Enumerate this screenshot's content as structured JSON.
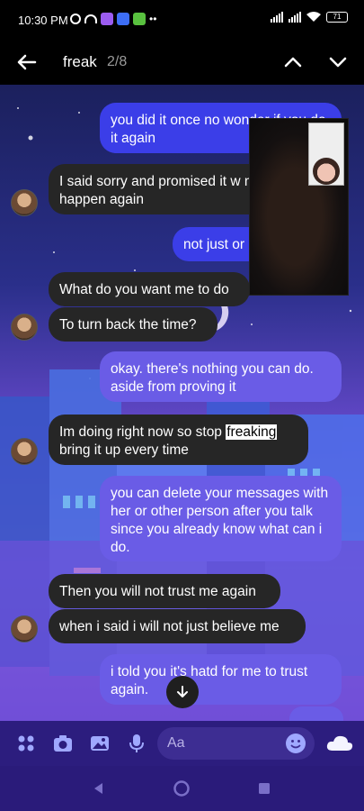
{
  "status_bar": {
    "time": "10:30 PM",
    "battery": "71"
  },
  "search": {
    "term": "freak",
    "count": "2/8"
  },
  "messages": [
    {
      "text": "you did it once no wonder if you do it again",
      "shown": "you did it once no wo"
    },
    {
      "text": "I said sorry and promised it w never happen again"
    },
    {
      "text": "not just or"
    },
    {
      "text": "What do you want me to do"
    },
    {
      "text": "To turn back the time?"
    },
    {
      "text": "okay. there's nothing you can do. aside from proving it"
    },
    {
      "before": "Im doing right now so stop ",
      "match": "freaking",
      "after": "bring it up every time"
    },
    {
      "text": "you can delete your messages with her or other person after you talk since you already know what can i do."
    },
    {
      "text": "Then you will not trust me again"
    },
    {
      "text": "when i said i will not just believe me"
    },
    {
      "text": "i told you it's hatd for me to trust again."
    }
  ],
  "composer": {
    "placeholder": "Aa"
  },
  "icons": {
    "back": "back-arrow-icon",
    "up": "chevron-up-icon",
    "down": "chevron-down-icon",
    "menu": "four-dots-icon",
    "camera": "camera-icon",
    "gallery": "gallery-icon",
    "mic": "microphone-icon",
    "emoji": "emoji-icon",
    "weather": "cloud-icon"
  },
  "colors": {
    "outgoing": "#3b3ee8",
    "incoming": "#262626",
    "highlight": "#ffffff",
    "accent": "#7f7ff0"
  }
}
